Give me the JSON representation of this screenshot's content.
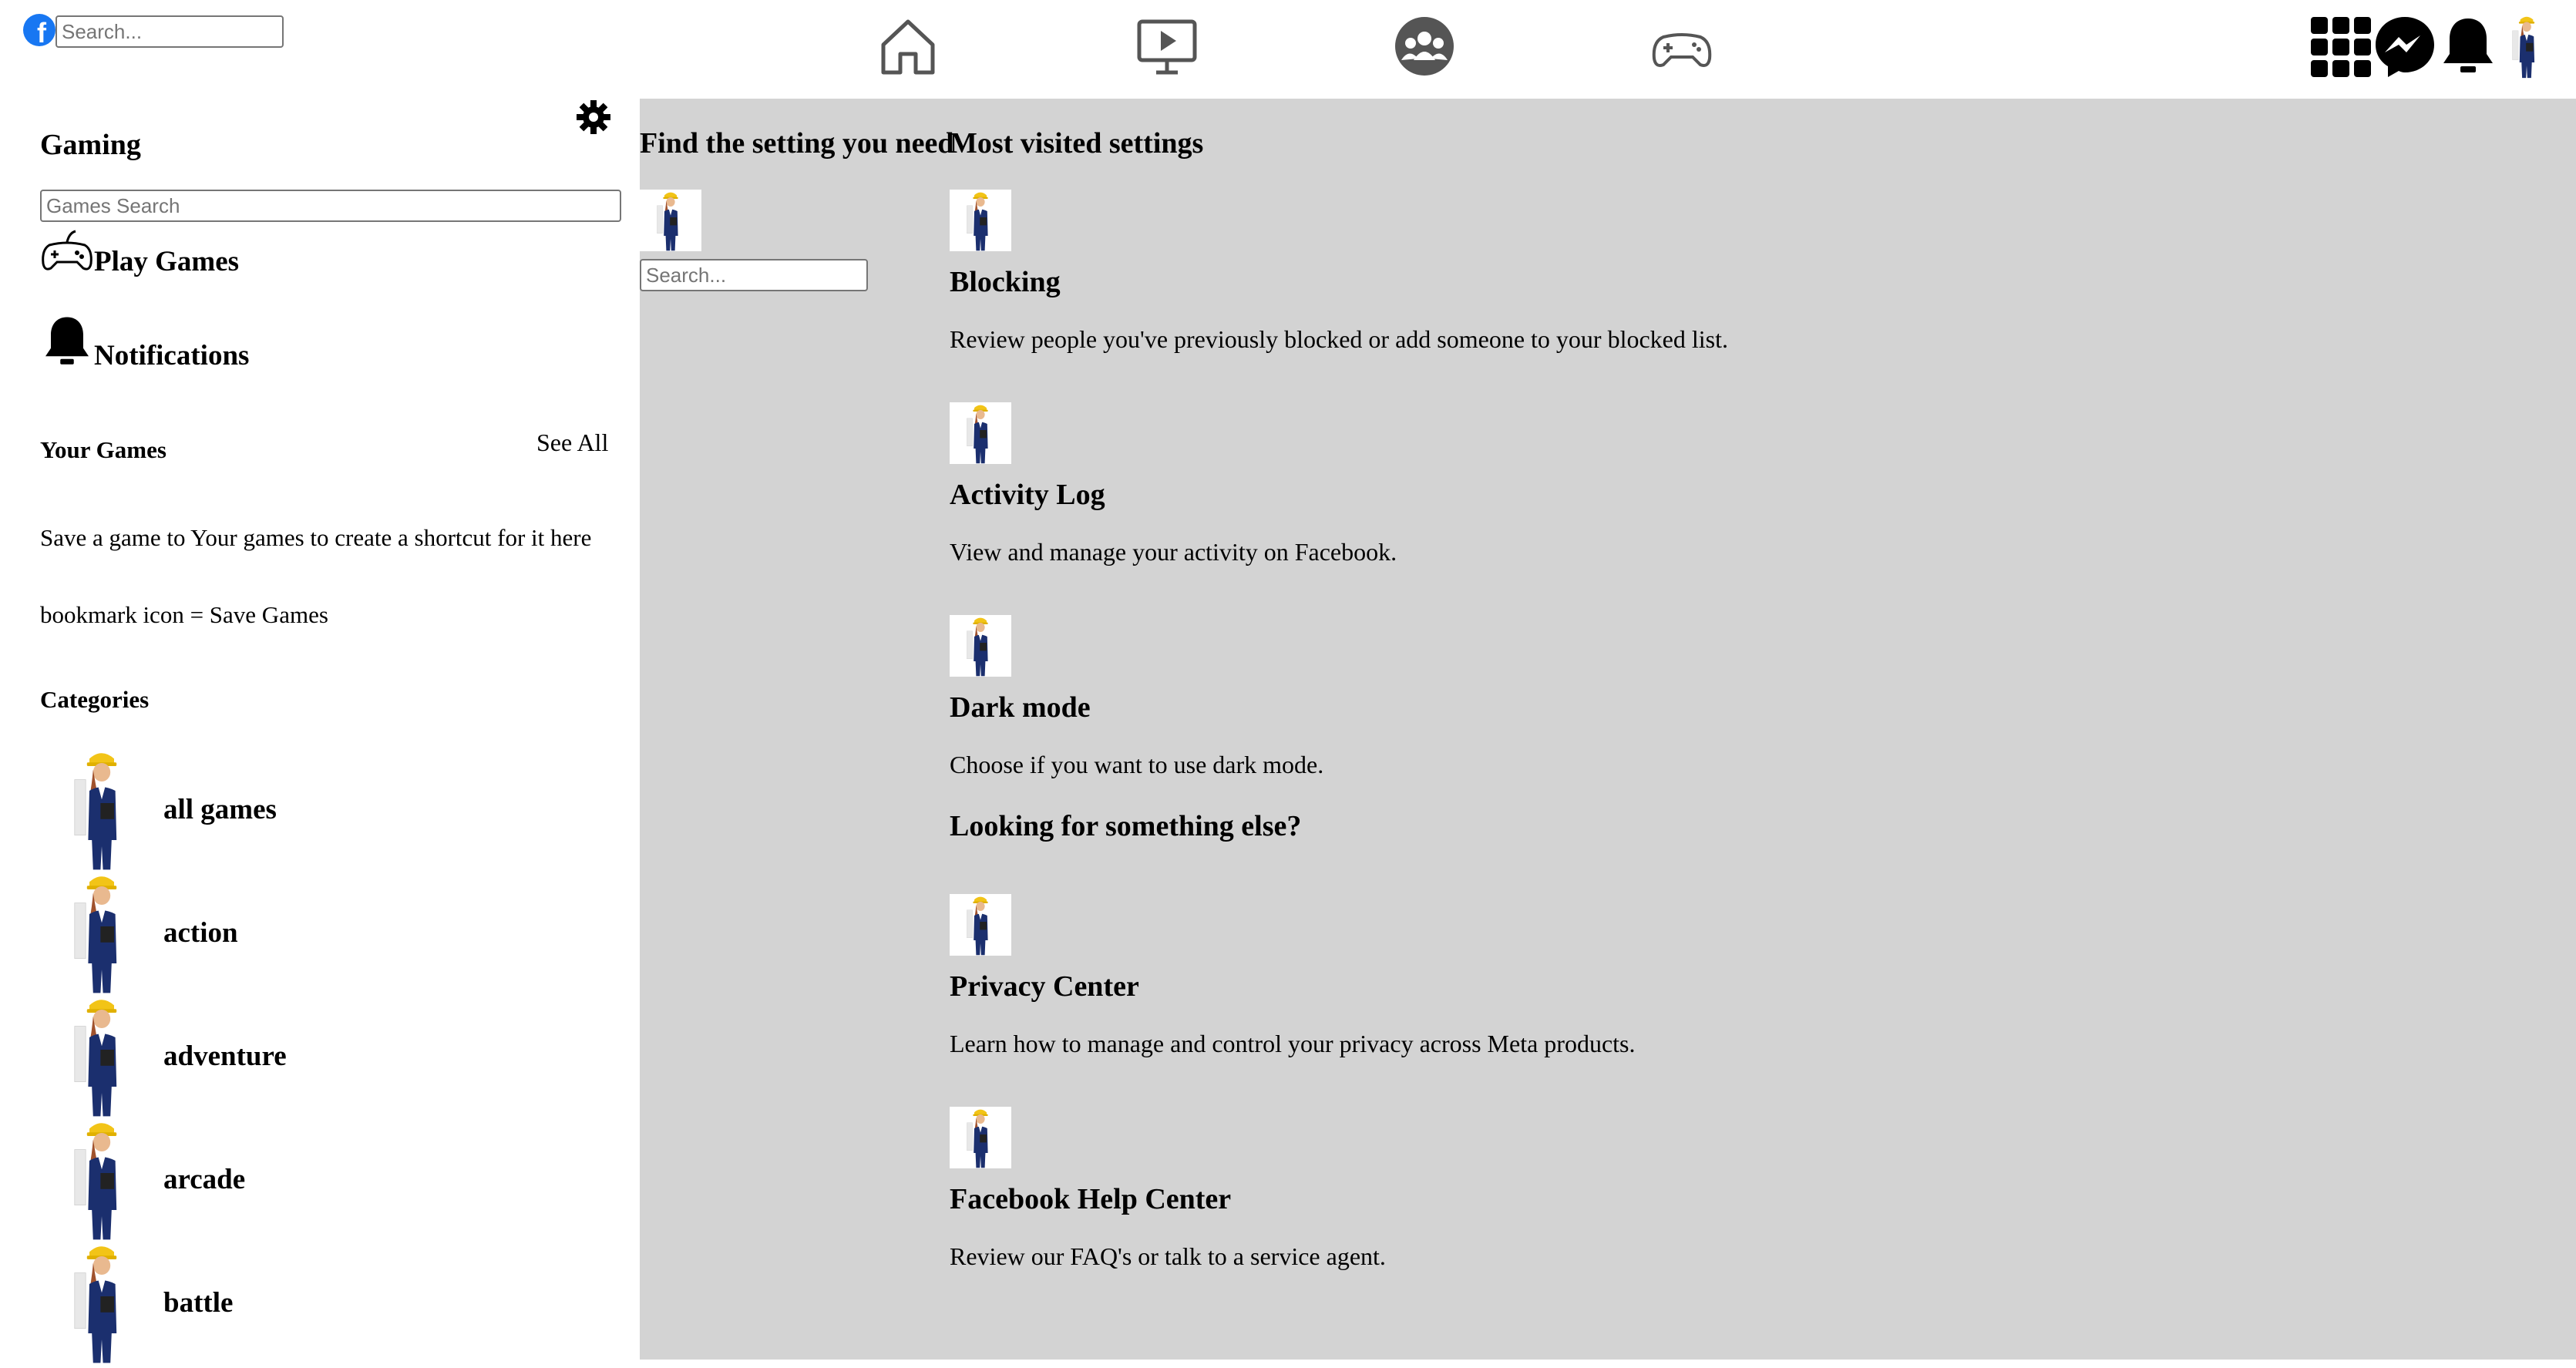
{
  "topbar": {
    "logo": "facebook-logo",
    "search_placeholder": "Search...",
    "nav_icons": [
      "home-icon",
      "watch-icon",
      "groups-icon",
      "gaming-icon"
    ],
    "right_icons": [
      "menu-grid-icon",
      "messenger-icon",
      "bell-icon",
      "avatar"
    ]
  },
  "sidebar": {
    "title": "Gaming",
    "settings_icon": "gear-icon",
    "search_placeholder": "Games Search",
    "play_games": "Play Games",
    "notifications": "Notifications",
    "your_games": "Your Games",
    "see_all": "See All",
    "empty_msg": "Save a game to Your games to create a shortcut for it here",
    "bookmark_hint": "bookmark icon = Save Games",
    "categories_title": "Categories",
    "categories": [
      "all games",
      "action",
      "adventure",
      "arcade",
      "battle"
    ]
  },
  "main": {
    "find_heading": "Find the setting you need",
    "search_placeholder": "Search...",
    "most_visited_heading": "Most visited settings",
    "settings": [
      {
        "title": "Blocking",
        "desc": "Review people you've previously blocked or add someone to your blocked list."
      },
      {
        "title": "Activity Log",
        "desc": "View and manage your activity on Facebook."
      },
      {
        "title": "Dark mode",
        "desc": "Choose if you want to use dark mode."
      }
    ],
    "something_else": "Looking for something else?",
    "other": [
      {
        "title": "Privacy Center",
        "desc": "Learn how to manage and control your privacy across Meta products."
      },
      {
        "title": "Facebook Help Center",
        "desc": "Review our FAQ's or talk to a service agent."
      }
    ]
  }
}
